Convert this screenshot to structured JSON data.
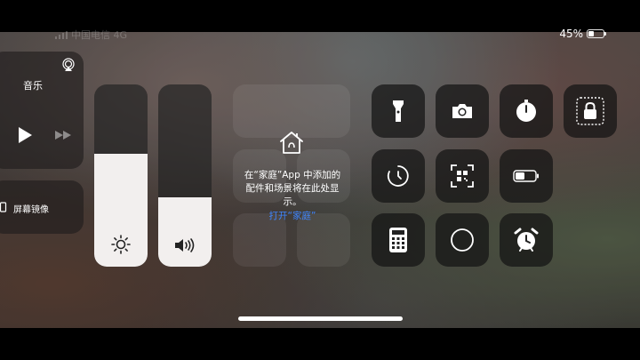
{
  "status_bar": {
    "carrier": "中国电信 4G",
    "battery_percent": "45%",
    "battery_level": 0.45
  },
  "music": {
    "title": "音乐"
  },
  "screen_mirroring": {
    "label": "屏幕镜像"
  },
  "brightness": {
    "level": 0.62
  },
  "volume": {
    "level": 0.38
  },
  "home": {
    "message": "在“家庭”App 中添加的配件和场景将在此处显示。",
    "link": "打开“家庭”"
  },
  "controls": [
    {
      "name": "flashlight-icon"
    },
    {
      "name": "camera-icon"
    },
    {
      "name": "timer-icon"
    },
    {
      "name": "rotation-lock-icon"
    },
    {
      "name": "screen-recording-icon"
    },
    {
      "name": "qr-code-scanner-icon"
    },
    {
      "name": "low-power-mode-icon"
    },
    {
      "name": "calculator-icon"
    },
    {
      "name": "dark-mode-icon"
    },
    {
      "name": "alarm-icon"
    }
  ],
  "colors": {
    "accent_link": "#3f86ff",
    "slider_fill": "#f2efee"
  }
}
